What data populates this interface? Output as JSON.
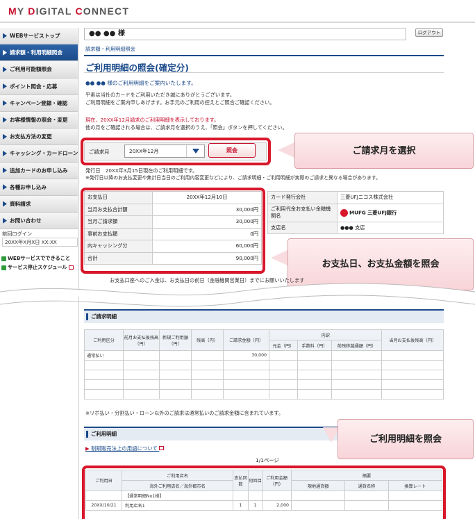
{
  "app": {
    "logo_text": "MY DIGITAL CONNECT"
  },
  "sidebar": {
    "items": [
      {
        "label": "WEBサービストップ"
      },
      {
        "label": "請求額・利用明細照会"
      },
      {
        "label": "ご利用可能額照会"
      },
      {
        "label": "ポイント照会・応募"
      },
      {
        "label": "キャンペーン登録・確認"
      },
      {
        "label": "お客様情報の照会・変更"
      },
      {
        "label": "お支払方法の変更"
      },
      {
        "label": "キャッシング・カードローン"
      },
      {
        "label": "追加カードのお申し込み"
      },
      {
        "label": "各種お申し込み"
      },
      {
        "label": "資料請求"
      },
      {
        "label": "お問い合わせ"
      }
    ],
    "prev_login_label": "前回ログイン",
    "prev_login_value": "20XX年X月X日 XX:XX",
    "link1": "WEBサービスでできること",
    "link2": "サービス停止スケジュール"
  },
  "header": {
    "user_name": "●● ●● 様",
    "logout_label": "ログアウト"
  },
  "breadcrumb": "請求額・利用明細照会",
  "page_title": "ご利用明細の照会(確定分)",
  "greeting": "●● ●● 様のご利用明細をご案内いたします。",
  "intro": [
    "平素は当社のカードをご利用いただき誠にありがとうございます。",
    "ご利用明細をご案内申しあげます。お手元のご利用の控えとご照合ご確認ください。"
  ],
  "notice_red": "現在、20XX年12月請求のご利用明細を表示しております。",
  "notice_sub": "他の月をご確認される場合は、ご請求月を選択のうえ、「照会」ボタンを押してください。",
  "select": {
    "label": "ご請求月",
    "value": "20XX年12月",
    "button": "照会"
  },
  "issue_lines": [
    "発行日　20XX年3月15日現在のご利用明細です。",
    "※発行日以降のお支払変更や集計日当日のご利用内容変更などにより、ご請求明細・ご利用明細が実際のご請求と異なる場合があります。"
  ],
  "payment": {
    "rows": [
      {
        "label": "お支払日",
        "value": "20XX年12月10日"
      },
      {
        "label": "当月お支払合計額",
        "value": "30,000円"
      },
      {
        "label": "当月ご請求額",
        "value": "30,000円"
      },
      {
        "label": "事前お支払額",
        "value": "0円"
      },
      {
        "label": "内キャッシング分",
        "value": "60,000円"
      },
      {
        "label": "合計",
        "value": "90,000円"
      }
    ]
  },
  "card_info": {
    "issuer_label": "カード発行会社",
    "issuer_value": "三菱UFJニコス株式会社",
    "bank_label": "ご利用代金お支払い金融機関名",
    "bank_value_a": "MUFG",
    "bank_value_b": "三菱UFJ銀行",
    "branch_label": "支店名",
    "branch_value": "●●● 支店"
  },
  "deposit_note": "お支払口座へのご入金は、お支払日の前日（金融機関営業日）までにお願いいたします",
  "billing": {
    "title": "ご請求明細",
    "headers": [
      "ご利用区分",
      "前月お支払後残高（円）",
      "新規ご利用額（円）",
      "残高（円）",
      "ご請求金額（円）",
      "内訳",
      "元金（円）",
      "手数料（円）",
      "前残移越通額（円）",
      "当月お支払後残高（円）"
    ],
    "row_label": "通常払い",
    "row_amount": "30,000"
  },
  "billing_note": "※リボ払い・分割払い・ローン以外のご請求は通常払いのご請求金額に含まれています。",
  "usage": {
    "title": "ご利用明細",
    "link": "割賦販売法上の用語について",
    "pager": "1/1ページ",
    "headers": [
      "ご利用日",
      "ご利用店名",
      "海外ご利用店名／海外都市名",
      "支払回数",
      "何回目",
      "ご利用金額（円）",
      "摘要",
      "現地通貨額",
      "通貨名称",
      "換算レート"
    ],
    "group_label": "【通常明細No1様】",
    "row_date": "20XX/10/21",
    "row_store": "利用店名1",
    "row_count": "1",
    "row_nth": "1",
    "row_amount": "2,000"
  },
  "callouts": [
    "ご請求月を選択",
    "お支払日、お支払金額を照会",
    "ご利用明細を照会"
  ],
  "colors": {
    "accent": "#1a4a8a",
    "red": "#d8172b"
  }
}
